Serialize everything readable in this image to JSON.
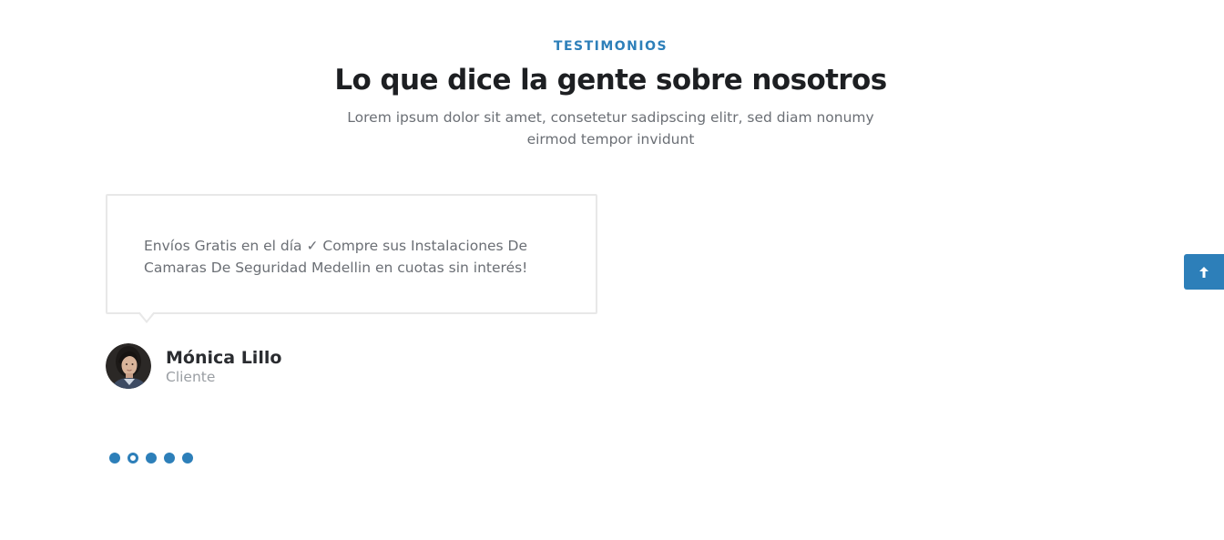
{
  "section": {
    "eyebrow": "TESTIMONIOS",
    "title": "Lo que dice la gente sobre nosotros",
    "subtitle": "Lorem ipsum dolor sit amet, consetetur sadipscing elitr, sed diam nonumy eirmod tempor invidunt"
  },
  "testimonial": {
    "quote": "Envíos Gratis en el día ✓ Compre sus Instalaciones De Camaras De Seguridad Medellin en cuotas sin interés!",
    "author_name": "Mónica Lillo",
    "author_role": "Cliente",
    "avatar_icon": "person-photo"
  },
  "carousel": {
    "dot_count": 5,
    "active_index": 1
  },
  "back_to_top": {
    "icon": "arrow-up-icon"
  },
  "colors": {
    "accent": "#2d7fb9",
    "heading": "#1d1f22",
    "body_text": "#6b6f75",
    "muted_text": "#9a9ea3",
    "border": "#e8e8e8"
  }
}
